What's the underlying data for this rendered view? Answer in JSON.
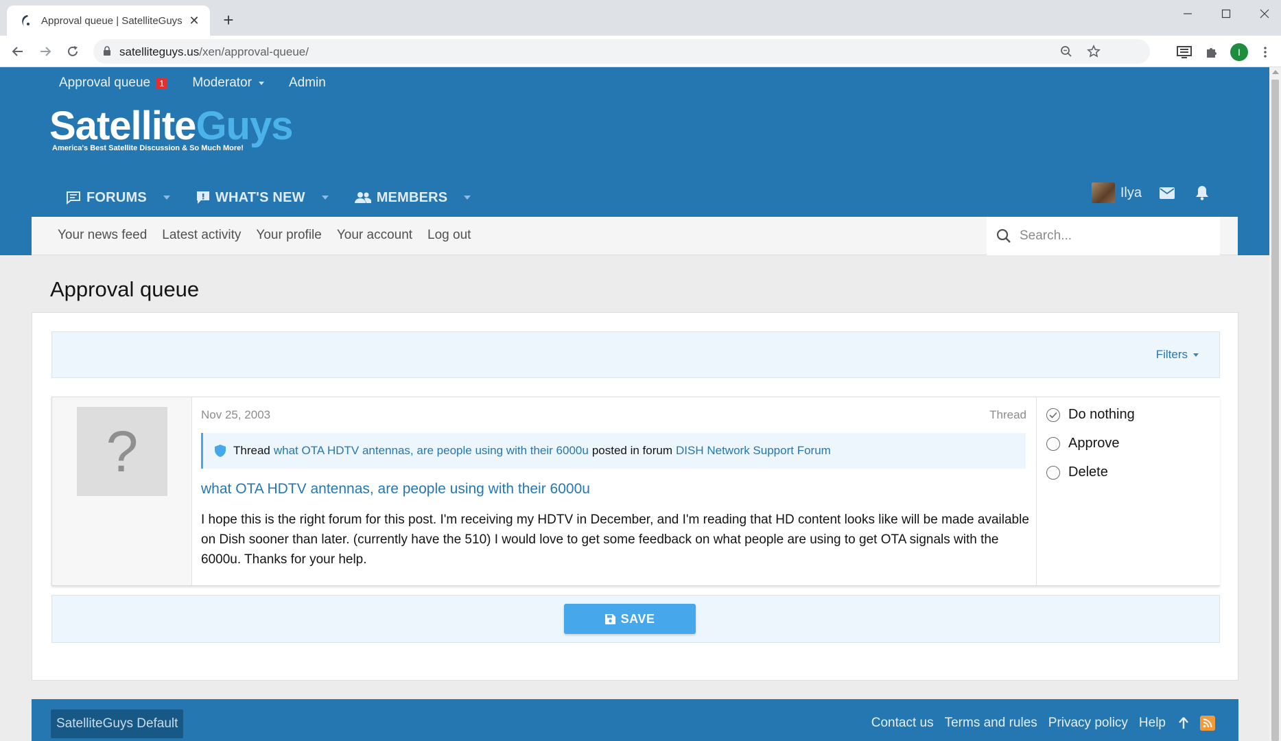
{
  "browser": {
    "tab_title": "Approval queue | SatelliteGuys.US",
    "url_host": "satelliteguys.us",
    "url_path": "/xen/approval-queue/",
    "profile_initial": "I"
  },
  "staffbar": {
    "approval_queue": "Approval queue",
    "approval_count": "1",
    "moderator": "Moderator",
    "admin": "Admin"
  },
  "logo": {
    "part1": "Satellite",
    "part2": "Guys",
    "tagline": "America's Best Satellite Discussion & So Much More!"
  },
  "mainnav": {
    "forums": "FORUMS",
    "whats_new": "WHAT'S NEW",
    "members": "MEMBERS"
  },
  "user": {
    "name": "Ilya"
  },
  "subnav": {
    "links": [
      "Your news feed",
      "Latest activity",
      "Your profile",
      "Your account",
      "Log out"
    ],
    "search_placeholder": "Search..."
  },
  "page": {
    "title": "Approval queue",
    "filters": "Filters"
  },
  "item": {
    "avatar_placeholder": "?",
    "date": "Nov 25, 2003",
    "type": "Thread",
    "notice_prefix": "Thread",
    "notice_link": "what OTA HDTV antennas, are people using with their 6000u",
    "notice_mid": "posted in forum",
    "notice_forum": "DISH Network Support Forum",
    "title": "what OTA HDTV antennas, are people using with their 6000u",
    "body": "I hope this is the right forum for this post. I'm receiving my HDTV in December, and I'm reading that HD content looks like will be made available on Dish sooner than later. (currently have the 510) I would love to get some feedback on what people are using to get OTA signals with the 6000u. Thanks for your help.",
    "actions": [
      "Do nothing",
      "Approve",
      "Delete"
    ],
    "selected_action": "Do nothing"
  },
  "save_label": "SAVE",
  "footer": {
    "style_chooser": "SatelliteGuys Default",
    "links": [
      "Contact us",
      "Terms and rules",
      "Privacy policy",
      "Help"
    ]
  },
  "colors": {
    "header_blue": "#2577b1",
    "button_blue": "#47a7eb",
    "link_blue": "#2577b1",
    "badge_red": "#e03030"
  }
}
